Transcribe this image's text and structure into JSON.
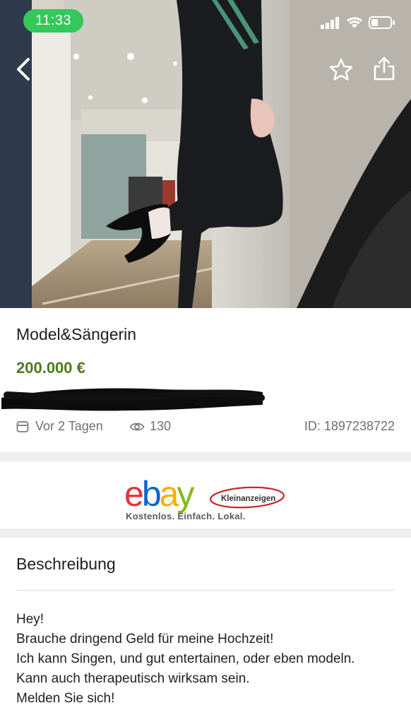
{
  "status_bar": {
    "time": "11:33",
    "icons": [
      "signal-icon",
      "wifi-icon",
      "battery-icon"
    ]
  },
  "top_actions": {
    "icons": [
      "back-chevron-icon",
      "star-icon",
      "share-icon"
    ]
  },
  "listing": {
    "title": "Model&Sängerin",
    "price": "200.000 €",
    "date": "Vor 2 Tagen",
    "views": "130",
    "id": "ID: 1897238722"
  },
  "brand": {
    "wordmark": "ebay",
    "badge": "Kleinanzeigen",
    "tagline": "Kostenlos. Einfach. Lokal."
  },
  "description": {
    "heading": "Beschreibung",
    "lines": [
      "Hey!",
      "Brauche dringend Geld für meine Hochzeit!",
      "Ich kann Singen, und gut entertainen, oder eben modeln.",
      "Kann auch therapeutisch wirksam sein.",
      "Melden Sie sich!"
    ]
  },
  "colors": {
    "price": "#4f7a1e",
    "status_pill": "#34c759",
    "ebay_e": "#e53238",
    "ebay_b": "#0064d2",
    "ebay_a": "#f5af02",
    "ebay_y": "#86b817"
  }
}
